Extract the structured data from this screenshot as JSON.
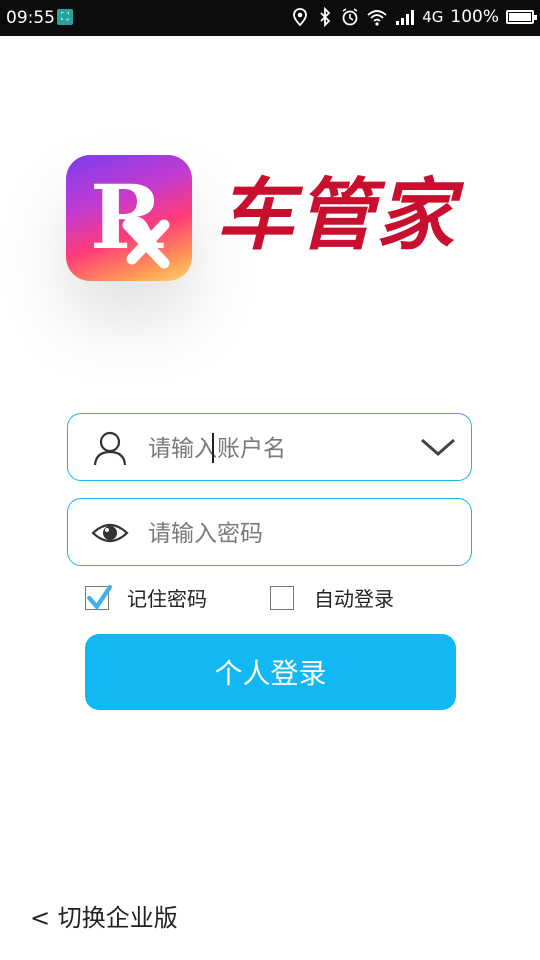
{
  "status_bar": {
    "time": "09:55",
    "network": "4G",
    "battery": "100%",
    "battery_level": 1.0
  },
  "brand": {
    "logo_letter": "R",
    "name": "车管家",
    "logo_colors": [
      "#7a3cf0",
      "#ff3b7a",
      "#ffd66a"
    ],
    "name_color": "#c8102e"
  },
  "login_form": {
    "username_placeholder": "请输入账户名",
    "password_placeholder": "请输入密码",
    "remember_password_label": "记住密码",
    "remember_password_checked": true,
    "auto_login_label": "自动登录",
    "auto_login_checked": false,
    "submit_label": "个人登录"
  },
  "footer": {
    "switch_link": "< 切换企业版"
  },
  "colors": {
    "accent": "#12b8f3",
    "field_border": "#18b8e8",
    "check_mark": "#3fb0e8"
  },
  "icons": {
    "status_left": "screenshot-notification-icon",
    "status_right": [
      "location-icon",
      "bluetooth-icon",
      "alarm-icon",
      "wifi-icon",
      "signal-icon",
      "battery-icon"
    ],
    "username": "user-icon",
    "password": "eye-icon",
    "dropdown": "chevron-down-icon"
  }
}
